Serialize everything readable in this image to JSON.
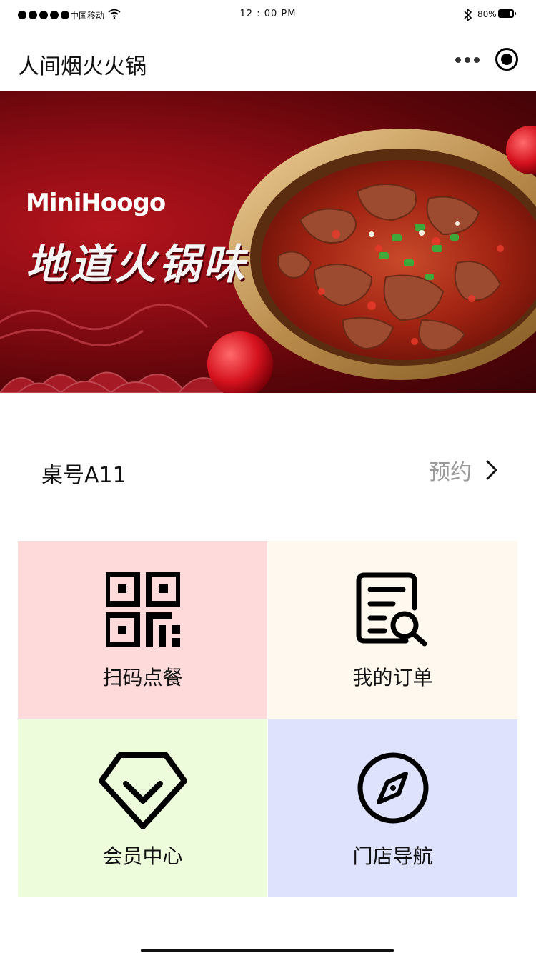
{
  "status_bar": {
    "carrier": "中国移动",
    "time": "12 : 00 PM",
    "battery_percent": "80%",
    "battery_level": 0.8
  },
  "nav": {
    "title": "人间烟火火锅",
    "more_icon": "more-dots-icon",
    "close_icon": "capsule-close-icon"
  },
  "banner": {
    "brand": "MiniHoogo",
    "slogan": "地道火锅味"
  },
  "table": {
    "label": "桌号A11",
    "reserve_label": "预约"
  },
  "tiles": [
    {
      "label": "扫码点餐",
      "icon": "qr-code-icon",
      "bg": "#ffdada"
    },
    {
      "label": "我的订单",
      "icon": "order-search-icon",
      "bg": "#fef8ee"
    },
    {
      "label": "会员中心",
      "icon": "diamond-icon",
      "bg": "#edfcdb"
    },
    {
      "label": "门店导航",
      "icon": "compass-icon",
      "bg": "#dfe2fd"
    }
  ]
}
